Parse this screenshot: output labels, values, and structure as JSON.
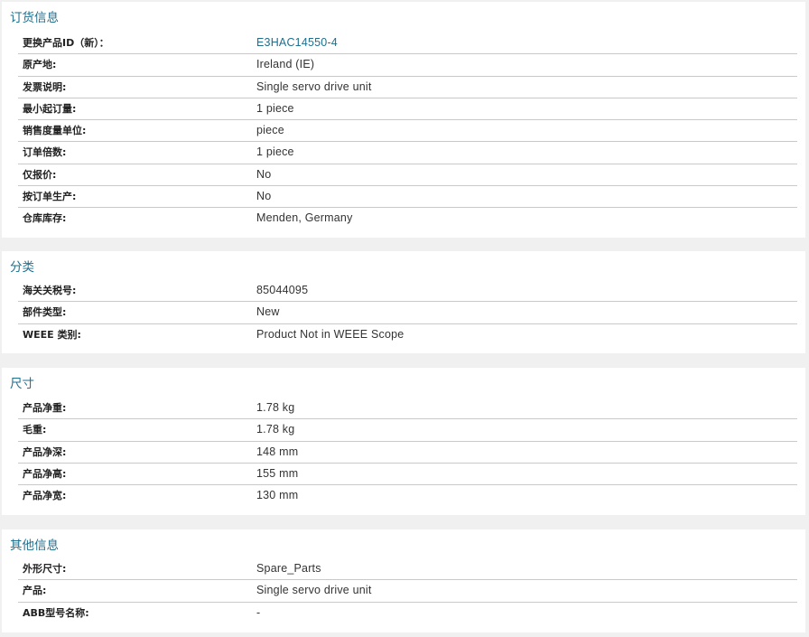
{
  "ordering": {
    "title": "订货信息",
    "rows": [
      {
        "label": "更换产品ID（新）：",
        "value": "E3HAC14550-4"
      },
      {
        "label": "原产地:",
        "value": "Ireland (IE)"
      },
      {
        "label": "发票说明:",
        "value": "Single servo drive unit"
      },
      {
        "label": "最小起订量:",
        "value": "1 piece"
      },
      {
        "label": "销售度量单位:",
        "value": "piece"
      },
      {
        "label": "订单倍数:",
        "value": "1 piece"
      },
      {
        "label": "仅报价:",
        "value": "No"
      },
      {
        "label": "按订单生产:",
        "value": "No"
      },
      {
        "label": "仓库库存:",
        "value": "Menden, Germany"
      }
    ]
  },
  "classification": {
    "title": "分类",
    "rows": [
      {
        "label": "海关关税号:",
        "value": "85044095"
      },
      {
        "label": "部件类型:",
        "value": "New"
      },
      {
        "label": "WEEE 类别:",
        "value": "Product Not in WEEE Scope"
      }
    ]
  },
  "dimensions": {
    "title": "尺寸",
    "rows": [
      {
        "label": "产品净重:",
        "value": "1.78 kg"
      },
      {
        "label": "毛重:",
        "value": "1.78 kg"
      },
      {
        "label": "产品净深:",
        "value": "148 mm"
      },
      {
        "label": "产品净高:",
        "value": "155 mm"
      },
      {
        "label": "产品净宽:",
        "value": "130 mm"
      }
    ]
  },
  "other": {
    "title": "其他信息",
    "rows": [
      {
        "label": "外形尺寸:",
        "value": "Spare_Parts"
      },
      {
        "label": "产品:",
        "value": "Single servo drive unit"
      },
      {
        "label": "ABB型号名称:",
        "value": "-"
      }
    ]
  },
  "colors": {
    "heading": "#1f6e8c",
    "link": "#1f6e8c",
    "background": "#f0f0f0",
    "divider": "#c9c9c9"
  }
}
